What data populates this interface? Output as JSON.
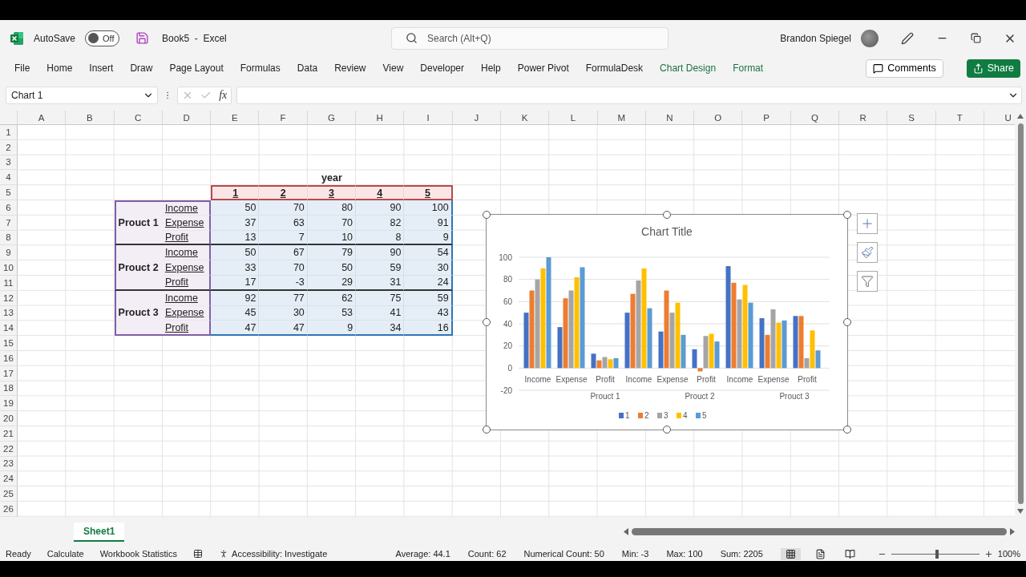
{
  "title_bar": {
    "autosave_label": "AutoSave",
    "autosave": {
      "label": "Off",
      "on": false
    },
    "document_title": "Book5  -  Excel",
    "search": {
      "placeholder": "Search (Alt+Q)"
    },
    "user_name": "Brandon Spiegel"
  },
  "ribbon_tabs": [
    {
      "label": "File",
      "kind": "standard"
    },
    {
      "label": "Home",
      "kind": "standard"
    },
    {
      "label": "Insert",
      "kind": "standard"
    },
    {
      "label": "Draw",
      "kind": "standard"
    },
    {
      "label": "Page Layout",
      "kind": "standard"
    },
    {
      "label": "Formulas",
      "kind": "standard"
    },
    {
      "label": "Data",
      "kind": "standard"
    },
    {
      "label": "Review",
      "kind": "standard"
    },
    {
      "label": "View",
      "kind": "standard"
    },
    {
      "label": "Developer",
      "kind": "standard"
    },
    {
      "label": "Help",
      "kind": "standard"
    },
    {
      "label": "Power Pivot",
      "kind": "standard"
    },
    {
      "label": "FormulaDesk",
      "kind": "standard"
    },
    {
      "label": "Chart Design",
      "kind": "contextual"
    },
    {
      "label": "Format",
      "kind": "contextual"
    }
  ],
  "ribbon_buttons": {
    "comments": "Comments",
    "share": "Share"
  },
  "formula_bar": {
    "name_box": "Chart 1",
    "function_label": "fx"
  },
  "columns": [
    "A",
    "B",
    "C",
    "D",
    "E",
    "F",
    "G",
    "H",
    "I",
    "J",
    "K",
    "L",
    "M",
    "N",
    "O",
    "P",
    "Q",
    "R",
    "S",
    "T",
    "U"
  ],
  "rows": [
    "1",
    "2",
    "3",
    "4",
    "5",
    "6",
    "7",
    "8",
    "9",
    "10",
    "11",
    "12",
    "13",
    "14",
    "15",
    "16",
    "17",
    "18",
    "19",
    "20",
    "21",
    "22",
    "23",
    "24",
    "25",
    "26"
  ],
  "table": {
    "header": "year",
    "year_columns": [
      "1",
      "2",
      "3",
      "4",
      "5"
    ],
    "products": [
      {
        "name": "Prouct 1",
        "rows": [
          {
            "label": "Income",
            "values": [
              "50",
              "70",
              "80",
              "90",
              "100"
            ]
          },
          {
            "label": "Expense",
            "values": [
              "37",
              "63",
              "70",
              "82",
              "91"
            ]
          },
          {
            "label": "Profit",
            "values": [
              "13",
              "7",
              "10",
              "8",
              "9"
            ]
          }
        ]
      },
      {
        "name": "Prouct 2",
        "rows": [
          {
            "label": "Income",
            "values": [
              "50",
              "67",
              "79",
              "90",
              "54"
            ]
          },
          {
            "label": "Expense",
            "values": [
              "33",
              "70",
              "50",
              "59",
              "30"
            ]
          },
          {
            "label": "Profit",
            "values": [
              "17",
              "-3",
              "29",
              "31",
              "24"
            ]
          }
        ]
      },
      {
        "name": "Prouct 3",
        "rows": [
          {
            "label": "Income",
            "values": [
              "92",
              "77",
              "62",
              "75",
              "59"
            ]
          },
          {
            "label": "Expense",
            "values": [
              "45",
              "30",
              "53",
              "41",
              "43"
            ]
          },
          {
            "label": "Profit",
            "values": [
              "47",
              "47",
              "9",
              "34",
              "16"
            ]
          }
        ]
      }
    ]
  },
  "chart": {
    "chart_data": {
      "type": "bar",
      "title": "Chart Title",
      "categories": [
        "Income",
        "Expense",
        "Profit",
        "Income",
        "Expense",
        "Profit",
        "Income",
        "Expense",
        "Profit"
      ],
      "series": [
        {
          "name": "1",
          "color": "#4472c4",
          "values": [
            50,
            37,
            13,
            50,
            33,
            17,
            92,
            45,
            47
          ]
        },
        {
          "name": "2",
          "color": "#ed7d31",
          "values": [
            70,
            63,
            7,
            67,
            70,
            -3,
            77,
            30,
            47
          ]
        },
        {
          "name": "3",
          "color": "#a5a5a5",
          "values": [
            80,
            70,
            10,
            79,
            50,
            29,
            62,
            53,
            9
          ]
        },
        {
          "name": "4",
          "color": "#ffc000",
          "values": [
            90,
            82,
            8,
            90,
            59,
            31,
            75,
            41,
            34
          ]
        },
        {
          "name": "5",
          "color": "#5b9bd5",
          "values": [
            100,
            91,
            9,
            54,
            30,
            24,
            59,
            43,
            16
          ]
        }
      ],
      "ylim": [
        -20,
        100
      ],
      "yticks": [
        -20,
        0,
        20,
        40,
        60,
        80,
        100
      ],
      "grid": true,
      "legend": "bottom"
    },
    "category_groups": [
      "Prouct 1",
      "Prouct 2",
      "Prouct 3"
    ]
  },
  "sheet_tabs": [
    {
      "label": "Sheet1",
      "selected": true
    }
  ],
  "status_bar": {
    "left": [
      "Ready",
      "Calculate",
      "Workbook Statistics"
    ],
    "accessibility": "Accessibility: Investigate",
    "stats": [
      "Average: 44.1",
      "Count: 62",
      "Numerical Count: 50",
      "Min: -3",
      "Max: 100",
      "Sum: 2205"
    ],
    "zoom": {
      "level": 0.52,
      "label": "100%"
    }
  }
}
